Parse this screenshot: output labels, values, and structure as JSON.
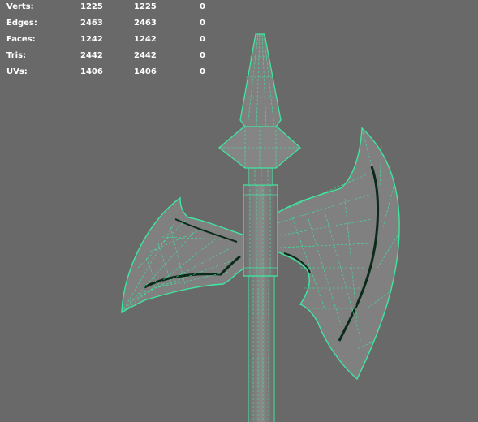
{
  "viewport": {
    "wire_color": "#3fe6a0",
    "wire_dark": "#0a2a1a",
    "mesh_fill": "#7d7d7d",
    "background": "#696969"
  },
  "hud": {
    "rows": [
      {
        "label": "Verts:",
        "values": [
          "1225",
          "1225",
          "0"
        ]
      },
      {
        "label": "Edges:",
        "values": [
          "2463",
          "2463",
          "0"
        ]
      },
      {
        "label": "Faces:",
        "values": [
          "1242",
          "1242",
          "0"
        ]
      },
      {
        "label": "Tris:",
        "values": [
          "2442",
          "2442",
          "0"
        ]
      },
      {
        "label": "UVs:",
        "values": [
          "1406",
          "1406",
          "0"
        ]
      }
    ]
  }
}
